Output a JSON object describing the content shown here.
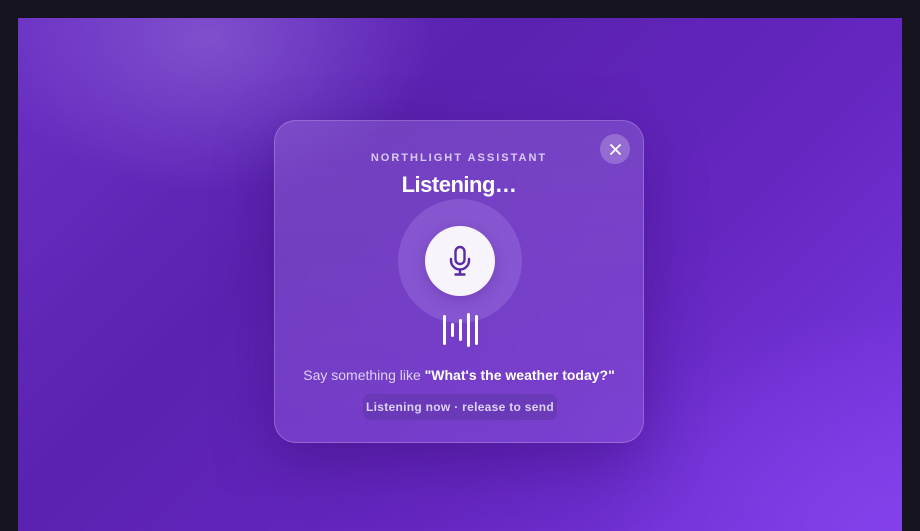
{
  "assistant": {
    "kicker": "NORTHLIGHT ASSISTANT",
    "title": "Listening…",
    "hint_prefix": "Say something like ",
    "hint_example": "\"What's the weather today?\"",
    "status": "Listening now · release to send"
  },
  "icons": {
    "close": "close-icon",
    "mic": "microphone-icon",
    "wave": "audio-wave-icon"
  },
  "colors": {
    "background": "#5a22b0",
    "mic_button": "#f7f5fb",
    "mic_icon": "#5b2aa6"
  }
}
